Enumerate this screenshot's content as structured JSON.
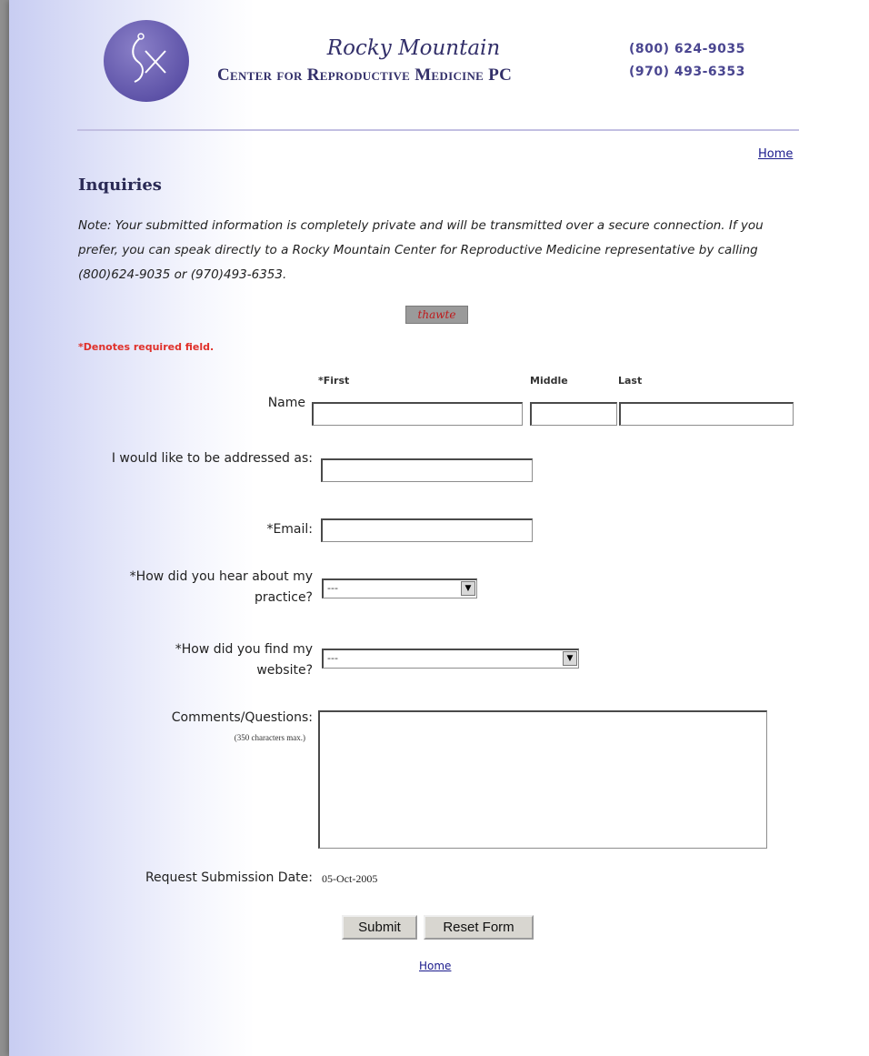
{
  "header": {
    "brand_script": "Rocky Mountain",
    "brand_name": "Center for Reproductive Medicine PC",
    "phone_1": "(800) 624-9035",
    "phone_2": "(970) 493-6353",
    "logo_icon": "logo-monogram-icon"
  },
  "nav": {
    "home_top": "Home",
    "home_bottom": "Home"
  },
  "title": "Inquiries",
  "note": "Note: Your submitted information is completely private and will be transmitted over a secure connection. If you prefer, you can speak directly to a Rocky Mountain Center for Reproductive Medicine representative by calling (800)624-9035 or (970)493-6353.",
  "seal": "thawte",
  "required_note": "*Denotes required field.",
  "form": {
    "name_label": "Name",
    "first_label": "*First",
    "middle_label": "Middle",
    "last_label": "Last",
    "address_label": "I would like to be addressed as:",
    "email_label": "*Email:",
    "hear_label": "*How did you hear about my practice?",
    "hear_selected": "---",
    "find_label": "*How did you find my website?",
    "find_selected": "---",
    "comments_label": "Comments/Questions:",
    "comments_hint": "(350 characters max.)",
    "date_label": "Request Submission Date:",
    "date_value": "05-Oct-2005",
    "submit_label": "Submit",
    "reset_label": "Reset Form"
  },
  "colors": {
    "accent": "#33306a",
    "required": "#e0302a",
    "rule": "#c2bfe2"
  }
}
